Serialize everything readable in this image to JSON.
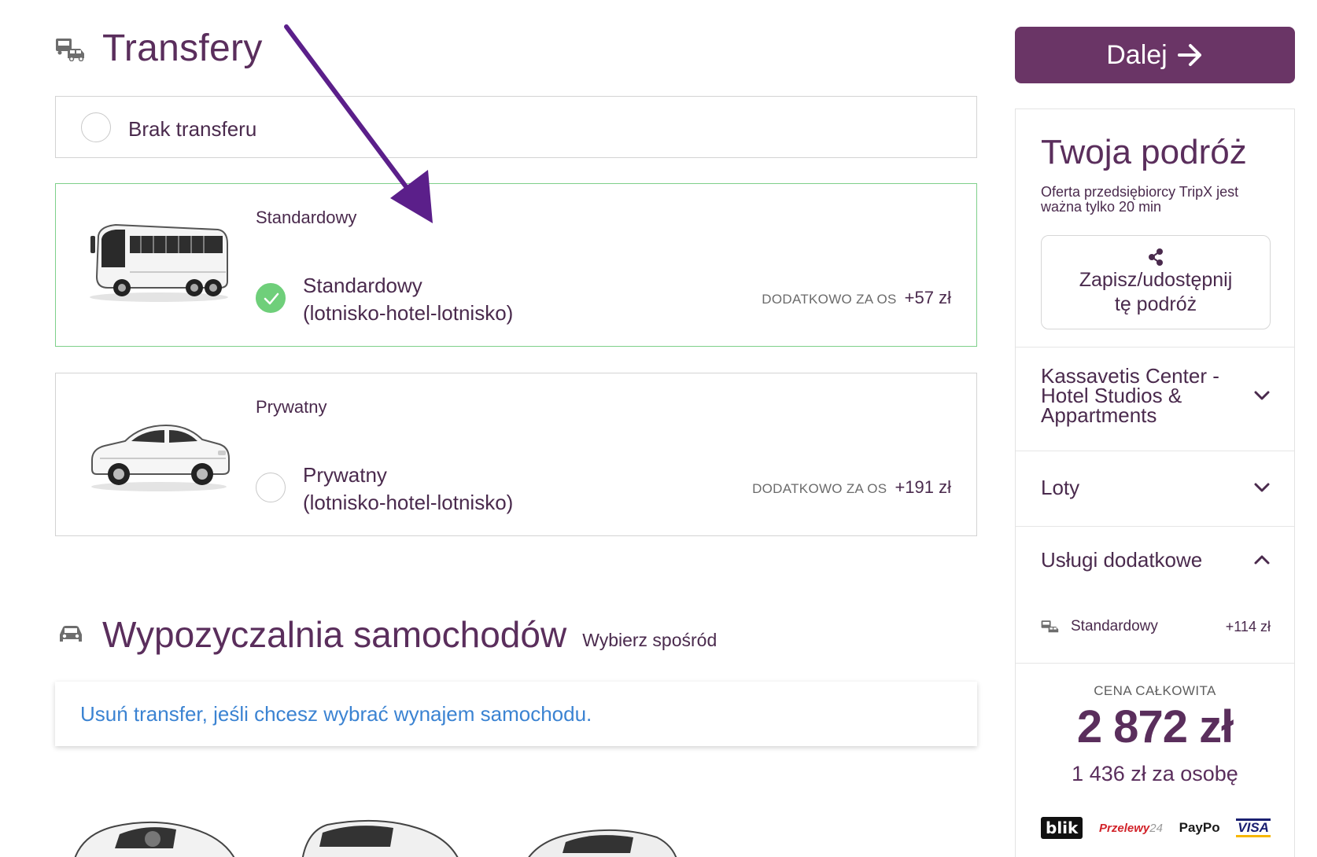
{
  "transfers": {
    "title": "Transfery",
    "no_transfer_label": "Brak transferu",
    "options": [
      {
        "category": "Standardowy",
        "name_line1": "Standardowy",
        "name_line2": "(lotnisko-hotel-lotnisko)",
        "extra_label": "DODATKOWO ZA OS",
        "price": "+57 zł",
        "selected": true
      },
      {
        "category": "Prywatny",
        "name_line1": "Prywatny",
        "name_line2": "(lotnisko-hotel-lotnisko)",
        "extra_label": "DODATKOWO ZA OS",
        "price": "+191 zł",
        "selected": false
      }
    ]
  },
  "car_rental": {
    "title": "Wypozyczalnia samochodów",
    "subtitle": "Wybierz spośród",
    "notice_link": "Usuń transfer, jeśli chcesz wybrać wynajem samochodu."
  },
  "summary": {
    "next_button": "Dalej",
    "title": "Twoja podróż",
    "offer_note": "Oferta przedsiębiorcy TripX jest ważna tylko 20 min",
    "share_line1": "Zapisz/udostępnij",
    "share_line2": "tę podróż",
    "hotel_line1": "Kassavetis Center -",
    "hotel_line2": "Hotel Studios &",
    "hotel_line3": "Appartments",
    "flights_label": "Loty",
    "services_label": "Usługi dodatkowe",
    "service_item": {
      "label": "Standardowy",
      "price": "+114 zł"
    },
    "total_label": "CENA CAŁKOWITA",
    "total_value": "2 872 zł",
    "per_person": "1 436 zł za osobę",
    "payment_logos": {
      "blik": "blik",
      "przelewy_main": "Przelewy",
      "przelewy_num": "24",
      "paypo": "PayPo",
      "visa": "VISA"
    }
  },
  "colors": {
    "brand_purple": "#6a3566",
    "selected_green": "#6fcf7a",
    "link_blue": "#3b83d2",
    "annotation_arrow": "#5b1f8a"
  },
  "icons": [
    "transfer-icon",
    "car-icon",
    "arrow-right-icon",
    "share-icon",
    "chevron-down-icon",
    "chevron-up-icon",
    "check-icon"
  ]
}
